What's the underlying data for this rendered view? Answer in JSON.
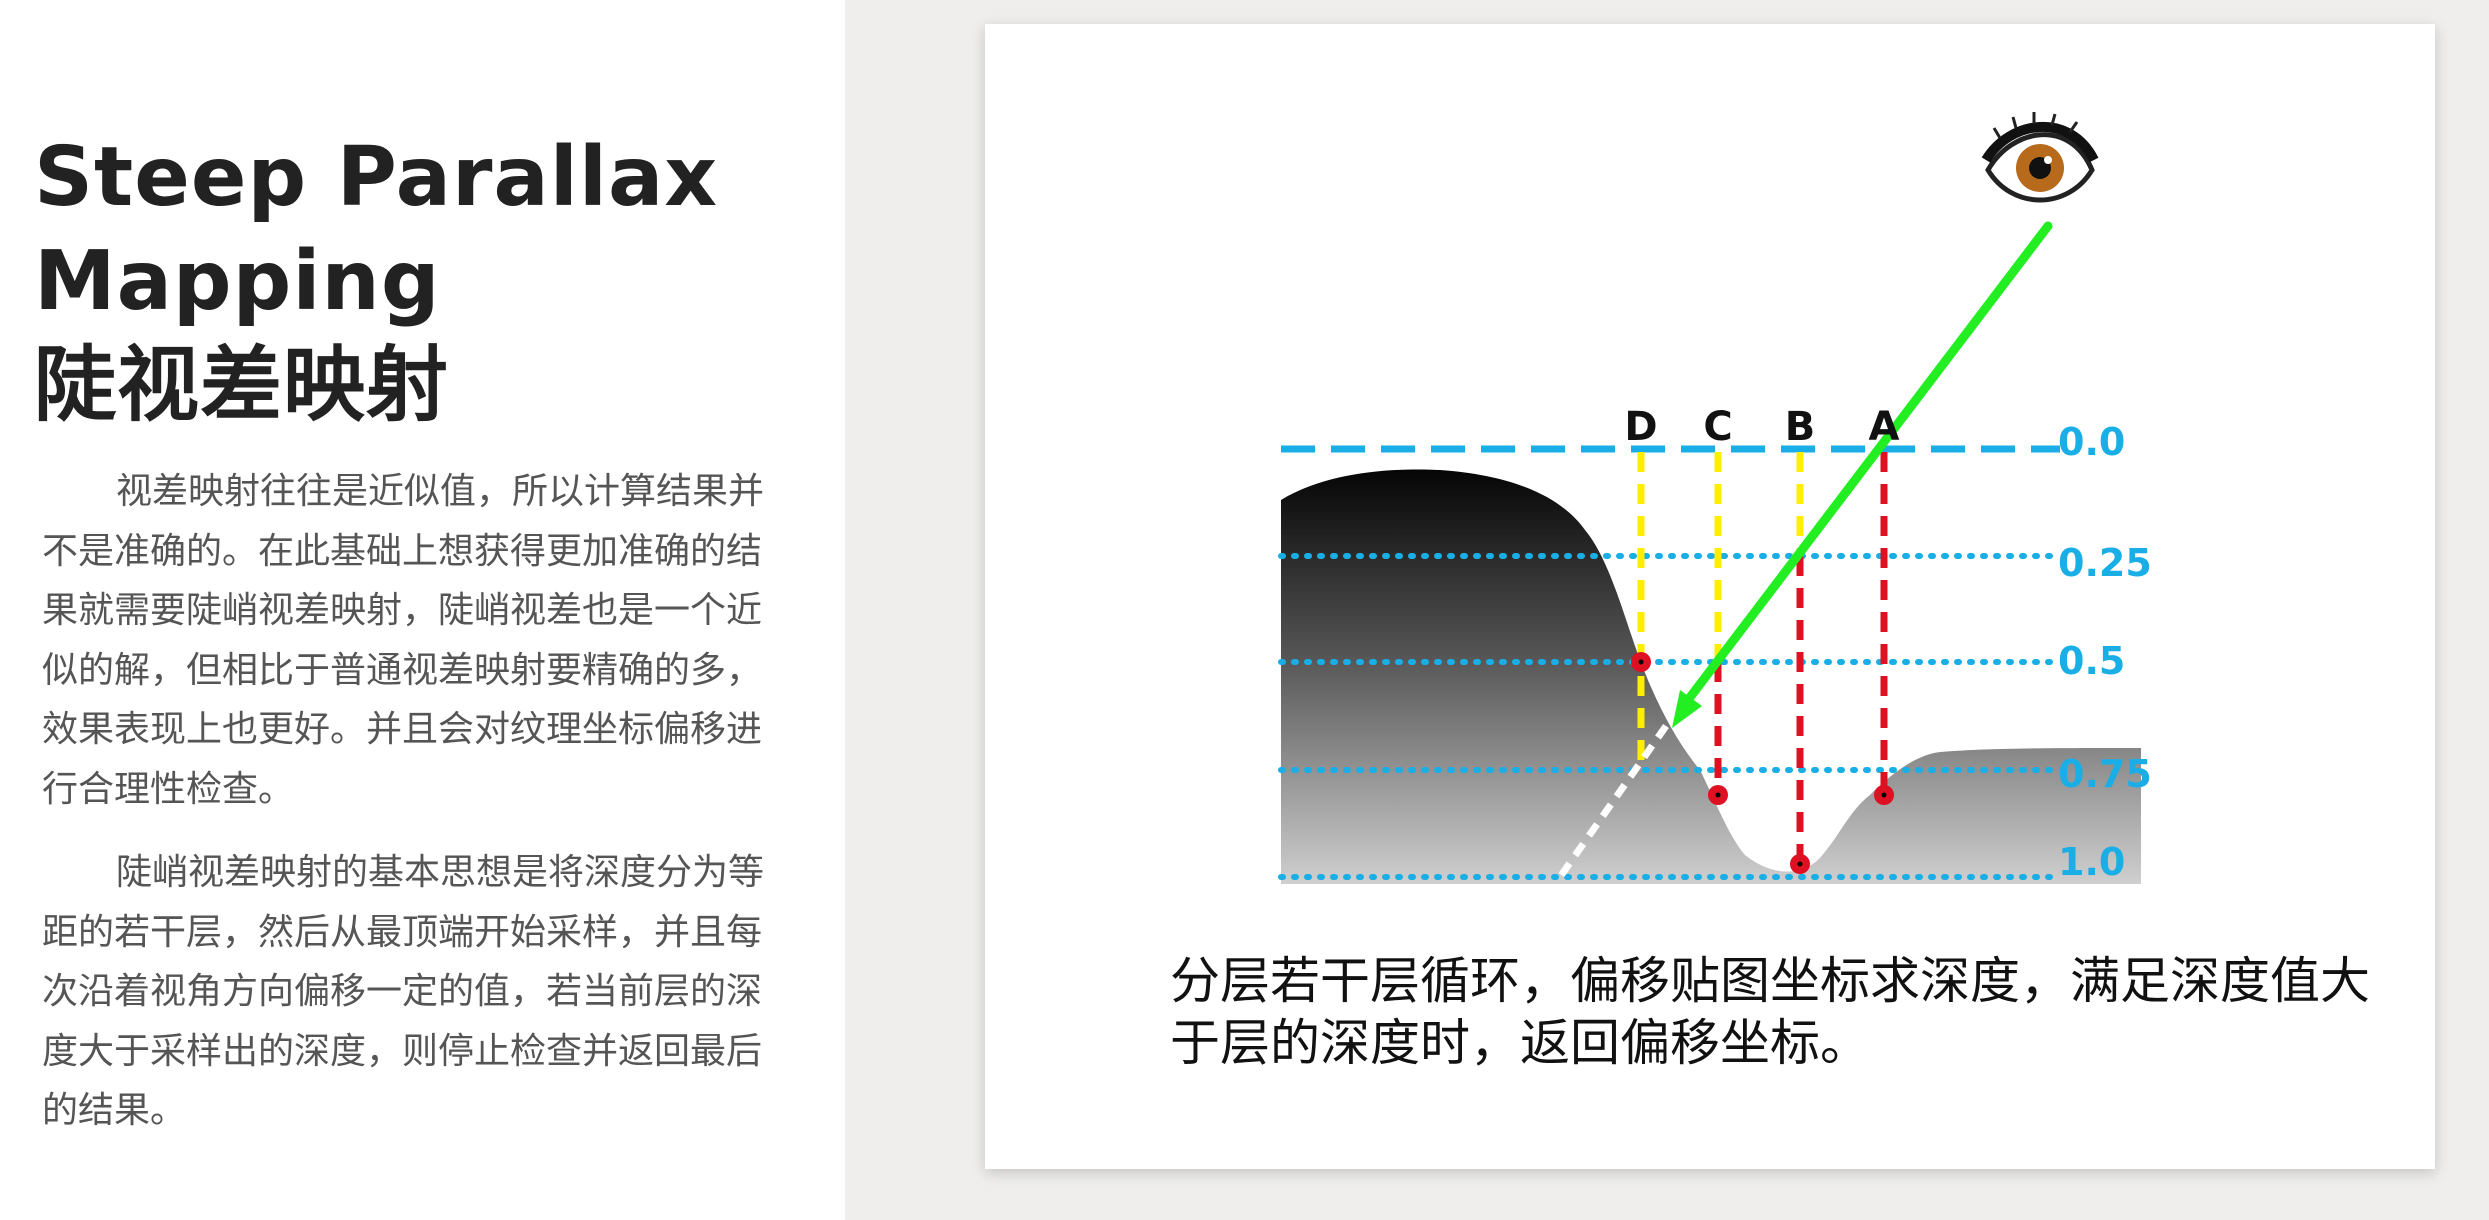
{
  "title": {
    "line1": "Steep Parallax",
    "line2": "Mapping",
    "line3": "陡视差映射"
  },
  "paragraphs": [
    "视差映射往往是近似值，所以计算结果并不是准确的。在此基础上想获得更加准确的结果就需要陡峭视差映射，陡峭视差也是一个近似的解，但相比于普通视差映射要精确的多，效果表现上也更好。并且会对纹理坐标偏移进行合理性检查。",
    "陡峭视差映射的基本思想是将深度分为等距的若干层，然后从最顶端开始采样，并且每次沿着视角方向偏移一定的值，若当前层的深度大于采样出的深度，则停止检查并返回最后的结果。"
  ],
  "diagram": {
    "depth_labels": [
      "0.0",
      "0.25",
      "0.5",
      "0.75",
      "1.0"
    ],
    "sample_labels": [
      "D",
      "C",
      "B",
      "A"
    ],
    "colors": {
      "layer_line": "#1aaee6",
      "view_ray": "#22ee22",
      "sample_line_yellow": "#ffee00",
      "sample_line_red": "#dd1122",
      "sample_point": "#dd1122",
      "label": "#111111"
    },
    "icons": [
      "eye-icon"
    ]
  },
  "caption": "分层若干层循环，偏移贴图坐标求深度，满足深度值大于层的深度时，返回偏移坐标。"
}
